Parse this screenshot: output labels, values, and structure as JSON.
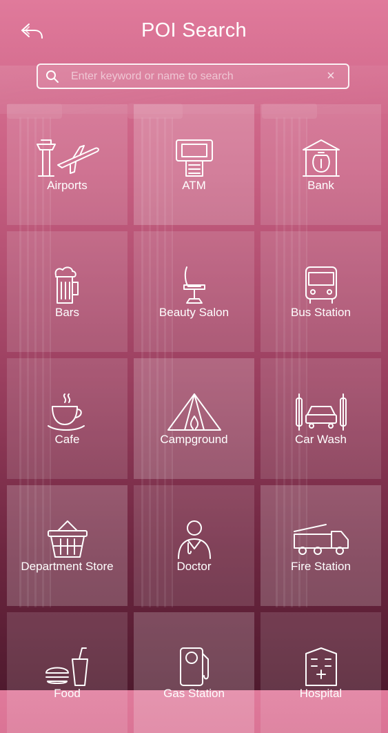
{
  "header": {
    "title": "POI Search",
    "back_icon": "back-arrow-icon"
  },
  "search": {
    "placeholder": "Enter keyword or name to search",
    "value": "",
    "clear_icon": "close-icon",
    "search_icon": "search-icon"
  },
  "categories": [
    {
      "label": "Airports",
      "icon": "airport-icon"
    },
    {
      "label": "ATM",
      "icon": "atm-icon"
    },
    {
      "label": "Bank",
      "icon": "bank-icon"
    },
    {
      "label": "Bars",
      "icon": "beer-mug-icon"
    },
    {
      "label": "Beauty Salon",
      "icon": "salon-chair-icon"
    },
    {
      "label": "Bus Station",
      "icon": "bus-icon"
    },
    {
      "label": "Cafe",
      "icon": "coffee-cup-icon"
    },
    {
      "label": "Campground",
      "icon": "tent-icon"
    },
    {
      "label": "Car Wash",
      "icon": "car-wash-icon"
    },
    {
      "label": "Department Store",
      "icon": "basket-icon"
    },
    {
      "label": "Doctor",
      "icon": "doctor-icon"
    },
    {
      "label": "Fire Station",
      "icon": "fire-truck-icon"
    },
    {
      "label": "Food",
      "icon": "fast-food-icon"
    },
    {
      "label": "Gas Station",
      "icon": "fuel-pump-icon"
    },
    {
      "label": "Hospital",
      "icon": "hospital-icon"
    }
  ],
  "colors": {
    "bg_top": "#e07a9b",
    "bg_bottom": "#4f1a2e",
    "text": "#ffffff"
  }
}
